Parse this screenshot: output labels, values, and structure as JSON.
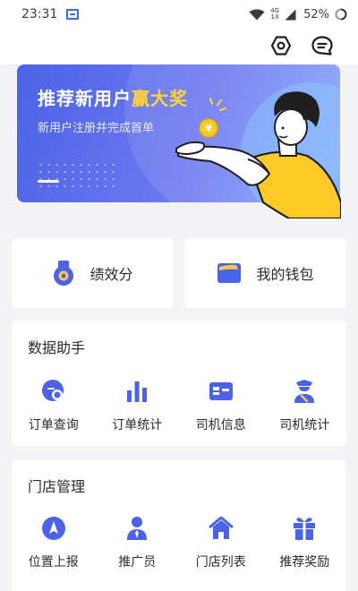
{
  "colors": {
    "accent": "#4a63e8",
    "highlight": "#ffd43b",
    "background": "#f3f3f5"
  },
  "status_bar": {
    "time": "23:31",
    "network_top": "4G",
    "network_bottom": "1X",
    "battery": "52%",
    "icons": [
      "app-notification-icon",
      "wifi-icon",
      "signal-icon",
      "battery-icon"
    ]
  },
  "header": {
    "icons": [
      "settings-icon",
      "message-icon"
    ]
  },
  "banner": {
    "title_main": "推荐新用户",
    "title_highlight": "赢大奖",
    "subtitle": "新用户注册并完成首单",
    "coin_symbol": "¥"
  },
  "quick": [
    {
      "label": "绩效分",
      "icon": "medal-icon"
    },
    {
      "label": "我的钱包",
      "icon": "wallet-icon"
    }
  ],
  "data_assistant": {
    "title": "数据助手",
    "items": [
      {
        "label": "订单查询",
        "icon": "order-search-icon"
      },
      {
        "label": "订单统计",
        "icon": "bar-chart-icon"
      },
      {
        "label": "司机信息",
        "icon": "id-card-icon"
      },
      {
        "label": "司机统计",
        "icon": "driver-icon"
      }
    ]
  },
  "store_management": {
    "title": "门店管理",
    "items": [
      {
        "label": "位置上报",
        "icon": "location-icon"
      },
      {
        "label": "推广员",
        "icon": "promoter-icon"
      },
      {
        "label": "门店列表",
        "icon": "store-home-icon"
      },
      {
        "label": "推荐奖励",
        "icon": "gift-icon"
      }
    ]
  }
}
